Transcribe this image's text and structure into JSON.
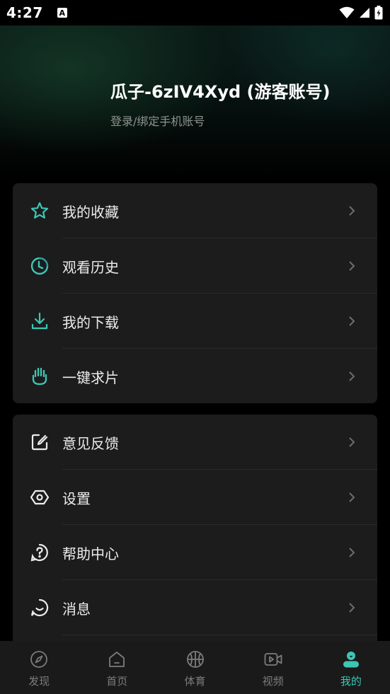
{
  "status_bar": {
    "time": "4:27",
    "notification_letter": "A"
  },
  "profile": {
    "username": "瓜子-6zIV4Xyd (游客账号)",
    "login_text": "登录/绑定手机账号"
  },
  "menu_group_1": [
    {
      "label": "我的收藏",
      "icon": "star-icon"
    },
    {
      "label": "观看历史",
      "icon": "clock-icon"
    },
    {
      "label": "我的下载",
      "icon": "download-icon"
    },
    {
      "label": "一键求片",
      "icon": "hand-icon"
    }
  ],
  "menu_group_2": [
    {
      "label": "意见反馈",
      "icon": "feedback-icon"
    },
    {
      "label": "设置",
      "icon": "settings-icon"
    },
    {
      "label": "帮助中心",
      "icon": "help-icon"
    },
    {
      "label": "消息",
      "icon": "message-icon"
    }
  ],
  "bottom_nav": [
    {
      "label": "发现",
      "icon": "compass-icon",
      "active": false
    },
    {
      "label": "首页",
      "icon": "home-icon",
      "active": false
    },
    {
      "label": "体育",
      "icon": "basketball-icon",
      "active": false
    },
    {
      "label": "视频",
      "icon": "video-icon",
      "active": false
    },
    {
      "label": "我的",
      "icon": "profile-icon",
      "active": true
    }
  ],
  "colors": {
    "accent": "#3cc7b4",
    "card_bg": "#1c1c1c",
    "background": "#000000"
  }
}
